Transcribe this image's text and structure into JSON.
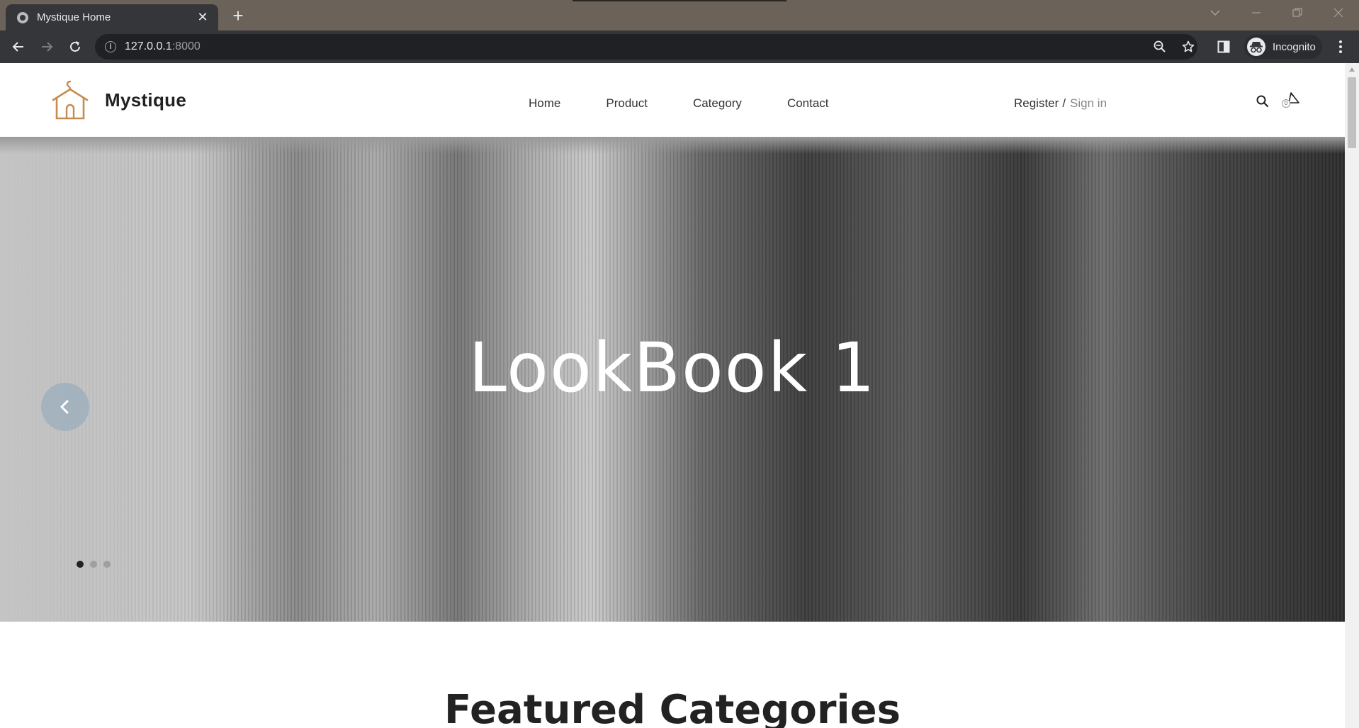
{
  "browser": {
    "tab_title": "Mystique Home",
    "new_tab_symbol": "+",
    "close_symbol": "✕",
    "url_host": "127.0.0.1",
    "url_port": ":8000",
    "incognito_label": "Incognito"
  },
  "site": {
    "brand": "Mystique",
    "nav": [
      {
        "label": "Home"
      },
      {
        "label": "Product"
      },
      {
        "label": "Category"
      },
      {
        "label": "Contact"
      }
    ],
    "auth": {
      "register": "Register",
      "separator": "/",
      "sign_in": "Sign in"
    },
    "cart_count": "0",
    "accent_color": "#c58b4f"
  },
  "hero": {
    "title": "LookBook 1",
    "slides_total": 3,
    "active_slide": 1
  },
  "sections": {
    "featured_title": "Featured Categories"
  }
}
